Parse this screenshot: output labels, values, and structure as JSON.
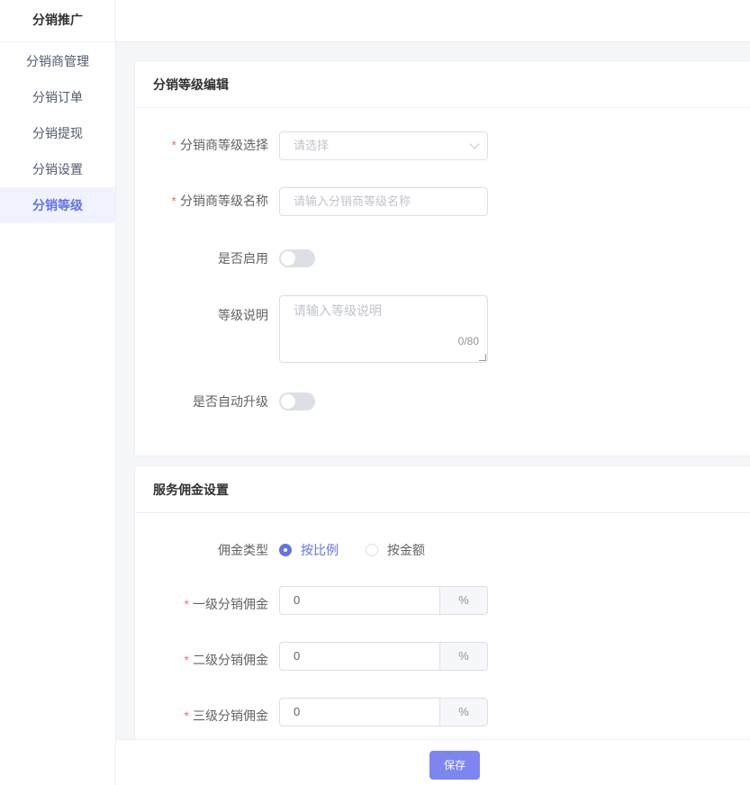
{
  "sidebar": {
    "title": "分销推广",
    "items": [
      {
        "label": "分销商管理"
      },
      {
        "label": "分销订单"
      },
      {
        "label": "分销提现"
      },
      {
        "label": "分销设置"
      },
      {
        "label": "分销等级"
      }
    ]
  },
  "level_card": {
    "title": "分销等级编辑",
    "level_select": {
      "label": "分销商等级选择",
      "placeholder": "请选择"
    },
    "level_name": {
      "label": "分销商等级名称",
      "placeholder": "请输入分销商等级名称"
    },
    "enabled": {
      "label": "是否启用"
    },
    "description": {
      "label": "等级说明",
      "placeholder": "请输入等级说明",
      "count": "0/80"
    },
    "auto_upgrade": {
      "label": "是否自动升级"
    }
  },
  "commission_card": {
    "title": "服务佣金设置",
    "type_label": "佣金类型",
    "type_options": [
      "按比例",
      "按金额"
    ],
    "level1": {
      "label": "一级分销佣金",
      "value": "0",
      "unit": "%"
    },
    "level2": {
      "label": "二级分销佣金",
      "value": "0",
      "unit": "%"
    },
    "level3": {
      "label": "三级分销佣金",
      "value": "0",
      "unit": "%"
    }
  },
  "footer": {
    "save_label": "保存"
  },
  "colors": {
    "accent": "#6473e0",
    "button": "#7c86ee",
    "required": "#f56c6c"
  }
}
